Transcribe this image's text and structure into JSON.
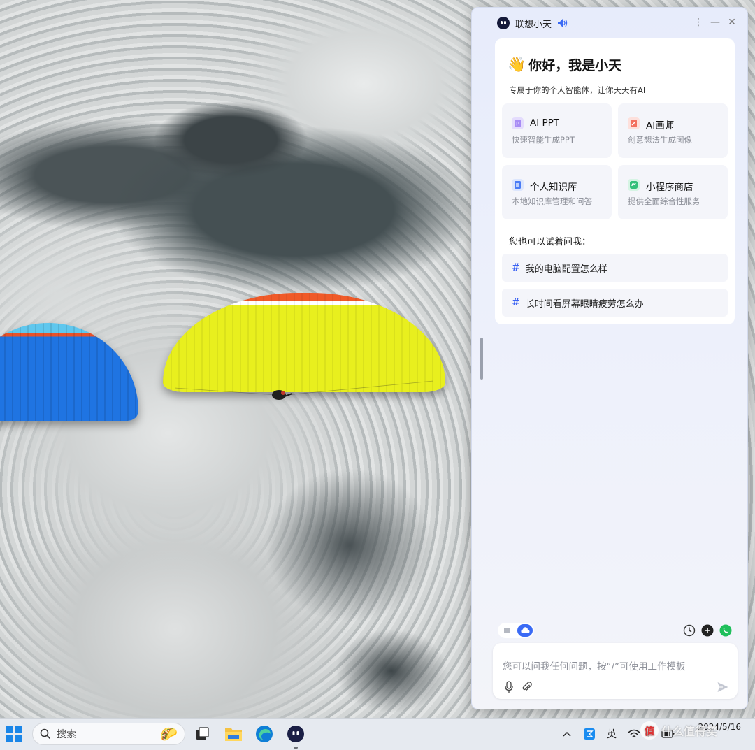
{
  "assistant": {
    "app_name": "联想小天",
    "greeting": "你好，我是小天",
    "subtitle": "专属于你的个人智能体，让你天天有AI",
    "tiles": [
      {
        "title": "AI PPT",
        "desc": "快速智能生成PPT",
        "icon": "ppt-icon",
        "color": "#a88cf5"
      },
      {
        "title": "AI画师",
        "desc": "创意想法生成图像",
        "icon": "painter-icon",
        "color": "#f37060"
      },
      {
        "title": "个人知识库",
        "desc": "本地知识库管理和问答",
        "icon": "knowledge-base-icon",
        "color": "#4a7cf5"
      },
      {
        "title": "小程序商店",
        "desc": "提供全面综合性服务",
        "icon": "mini-program-store-icon",
        "color": "#34c07a"
      }
    ],
    "ask_heading": "您也可以试着问我：",
    "suggestions": [
      {
        "hash": "#",
        "text": "我的电脑配置怎么样"
      },
      {
        "hash": "#",
        "text": "长时间看屏幕眼睛疲劳怎么办"
      }
    ],
    "input_placeholder": "您可以问我任何问题，按“/”可使用工作模板",
    "accent": "#3a6af5"
  },
  "taskbar": {
    "search_label": "搜索",
    "ime_label": "英",
    "date": "2024/5/16"
  },
  "watermark": {
    "glyph": "值",
    "text": "什么值得买"
  }
}
